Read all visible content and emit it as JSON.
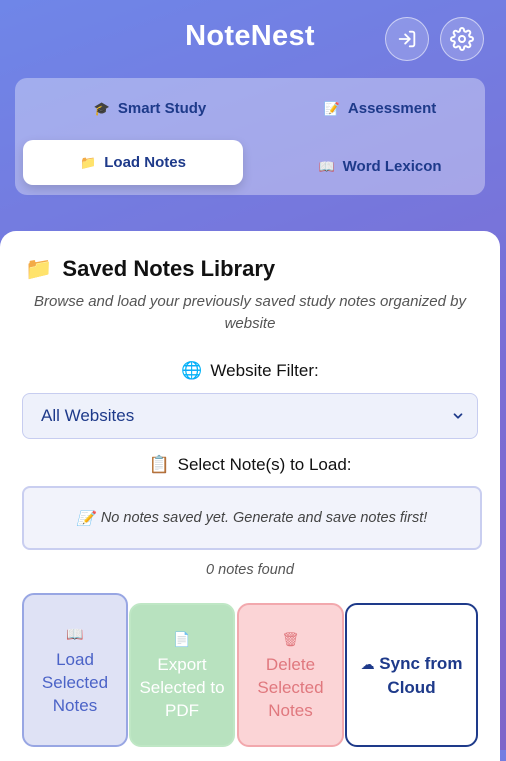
{
  "app": {
    "title": "NoteNest"
  },
  "header": {
    "logout_icon": "logout-icon",
    "settings_icon": "gear-icon"
  },
  "tabs": [
    {
      "label": "Smart Study",
      "icon": "🎓",
      "active": false
    },
    {
      "label": "Assessment",
      "icon": "📝",
      "active": false
    },
    {
      "label": "Load Notes",
      "icon": "📁",
      "active": true
    },
    {
      "label": "Word Lexicon",
      "icon": "📖",
      "active": false
    }
  ],
  "panel": {
    "icon": "📁",
    "title": "Saved Notes Library",
    "description": "Browse and load your previously saved study notes organized by website",
    "filter_icon": "🌐",
    "filter_label": "Website Filter:",
    "filter_value": "All Websites",
    "select_icon": "📋",
    "select_label": "Select Note(s) to Load:",
    "empty_icon": "📝",
    "empty_text": "No notes saved yet. Generate and save notes first!",
    "count_text": "0 notes found"
  },
  "actions": {
    "load": {
      "icon": "📖",
      "label": "Load Selected Notes"
    },
    "export": {
      "icon": "📄",
      "label": "Export Selected to PDF"
    },
    "delete": {
      "icon": "🗑",
      "label": "Delete Selected Notes"
    },
    "sync": {
      "icon": "☁",
      "label": "Sync from Cloud"
    }
  },
  "colors": {
    "accent": "#1e3a8a",
    "header_gradient_start": "#6f86e8",
    "header_gradient_end": "#7f66c9"
  }
}
